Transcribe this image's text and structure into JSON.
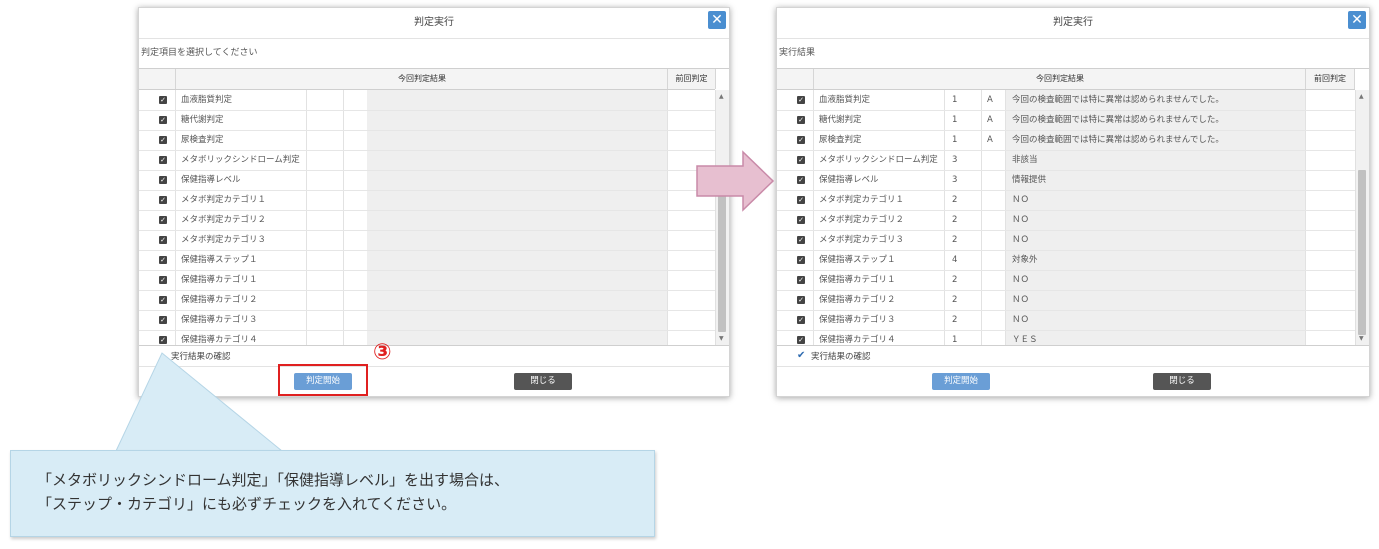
{
  "left_dialog": {
    "title": "判定実行",
    "close_glyph": "✕",
    "subtitle": "判定項目を選択してください",
    "col_current": "今回判定結果",
    "col_previous": "前回判定",
    "rows": [
      {
        "label": "血液脂質判定"
      },
      {
        "label": "糖代謝判定"
      },
      {
        "label": "尿検査判定"
      },
      {
        "label": "メタボリックシンドローム判定"
      },
      {
        "label": "保健指導レベル"
      },
      {
        "label": "メタボ判定カテゴリ１"
      },
      {
        "label": "メタボ判定カテゴリ２"
      },
      {
        "label": "メタボ判定カテゴリ３"
      },
      {
        "label": "保健指導ステップ１"
      },
      {
        "label": "保健指導カテゴリ１"
      },
      {
        "label": "保健指導カテゴリ２"
      },
      {
        "label": "保健指導カテゴリ３"
      },
      {
        "label": "保健指導カテゴリ４"
      }
    ],
    "confirm_label": "実行結果の確認",
    "start_label": "判定開始",
    "close_label": "閉じる"
  },
  "right_dialog": {
    "title": "判定実行",
    "close_glyph": "✕",
    "subtitle": "実行結果",
    "col_current": "今回判定結果",
    "col_previous": "前回判定",
    "rows": [
      {
        "label": "血液脂質判定",
        "code": "1",
        "grade": "A",
        "result": "今回の検査範囲では特に異常は認められませんでした。"
      },
      {
        "label": "糖代謝判定",
        "code": "1",
        "grade": "A",
        "result": "今回の検査範囲では特に異常は認められませんでした。"
      },
      {
        "label": "尿検査判定",
        "code": "1",
        "grade": "A",
        "result": "今回の検査範囲では特に異常は認められませんでした。"
      },
      {
        "label": "メタボリックシンドローム判定",
        "code": "3",
        "grade": "",
        "result": "非該当"
      },
      {
        "label": "保健指導レベル",
        "code": "3",
        "grade": "",
        "result": "情報提供"
      },
      {
        "label": "メタボ判定カテゴリ１",
        "code": "2",
        "grade": "",
        "result": "ＮＯ"
      },
      {
        "label": "メタボ判定カテゴリ２",
        "code": "2",
        "grade": "",
        "result": "ＮＯ"
      },
      {
        "label": "メタボ判定カテゴリ３",
        "code": "2",
        "grade": "",
        "result": "ＮＯ"
      },
      {
        "label": "保健指導ステップ１",
        "code": "4",
        "grade": "",
        "result": "対象外"
      },
      {
        "label": "保健指導カテゴリ１",
        "code": "2",
        "grade": "",
        "result": "ＮＯ"
      },
      {
        "label": "保健指導カテゴリ２",
        "code": "2",
        "grade": "",
        "result": "ＮＯ"
      },
      {
        "label": "保健指導カテゴリ３",
        "code": "2",
        "grade": "",
        "result": "ＮＯ"
      },
      {
        "label": "保健指導カテゴリ４",
        "code": "1",
        "grade": "",
        "result": "ＹＥＳ"
      }
    ],
    "confirm_label": "実行結果の確認",
    "start_label": "判定開始",
    "close_label": "閉じる"
  },
  "annotation": {
    "step_marker": "③",
    "callout_line1": "「メタボリックシンドローム判定」「保健指導レベル」を出す場合は、",
    "callout_line2": "「ステップ・カテゴリ」にも必ずチェックを入れてください。"
  },
  "colors": {
    "accent_blue": "#4a8ed0",
    "highlight_red": "#e02020",
    "arrow_pink": "#e7bfd0",
    "callout_bg": "#d8ecf6"
  }
}
